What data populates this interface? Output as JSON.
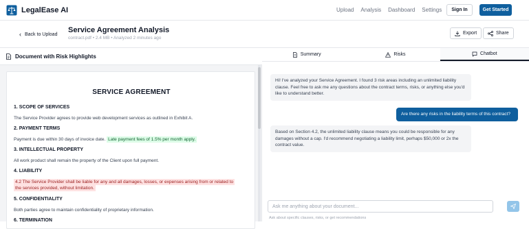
{
  "brand": {
    "name": "LegalEase AI"
  },
  "nav": {
    "links": [
      "Upload",
      "Analysis",
      "Dashboard",
      "Settings"
    ],
    "signin_label": "Sign In",
    "start_label": "Get Started"
  },
  "subheader": {
    "back_label": "Back to Upload",
    "title": "Service Agreement Analysis",
    "meta": "contract.pdf • 2.4 MB • Analyzed 2 minutes ago",
    "export_label": "Export",
    "share_label": "Share"
  },
  "document": {
    "panel_title": "Document with Risk Highlights",
    "title": "SERVICE AGREEMENT",
    "sections": [
      {
        "heading": "1. SCOPE OF SERVICES",
        "text": "The Service Provider agrees to provide web development services as outlined in Exhibit A."
      },
      {
        "heading": "2. PAYMENT TERMS",
        "text": "Payment is due within 30 days of invoice date.",
        "highlight": "Late payment fees of 1.5% per month apply."
      },
      {
        "heading": "3. INTELLECTUAL PROPERTY",
        "text": "All work product shall remain the property of the Client upon full payment."
      },
      {
        "heading": "4. LIABILITY",
        "highlight_line1": "4.2 The Service Provider shall be liable for any and all damages, losses, or expenses arising from or related to",
        "highlight_line2": "the services provided, without limitation."
      },
      {
        "heading": "5. CONFIDENTIALITY",
        "text": "Both parties agree to maintain confidentiality of proprietary information."
      },
      {
        "heading": "6. TERMINATION"
      }
    ]
  },
  "tabs": [
    "Summary",
    "Risks",
    "Chatbot"
  ],
  "chat": {
    "messages": [
      {
        "role": "bot",
        "text": "Hi! I've analyzed your Service Agreement. I found 3 risk areas including an unlimited liability clause. Feel free to ask me any questions about the contract terms, risks, or anything else you'd like to understand better."
      },
      {
        "role": "user",
        "text": "Are there any risks in the liability terms of this contract?"
      },
      {
        "role": "bot",
        "text": "Based on Section 4.2, the unlimited liability clause means you could be responsible for any damages without a cap. I'd recommend negotiating a liability limit, perhaps $50,000 or 2x the contract value."
      }
    ],
    "input_placeholder": "Ask me anything about your document...",
    "hint": "Ask about specific clauses, risks, or get recommendations"
  },
  "colors": {
    "accent": "#0f5f9e",
    "risk_red": "#fee2e2",
    "ok_green": "#dcfce7"
  }
}
